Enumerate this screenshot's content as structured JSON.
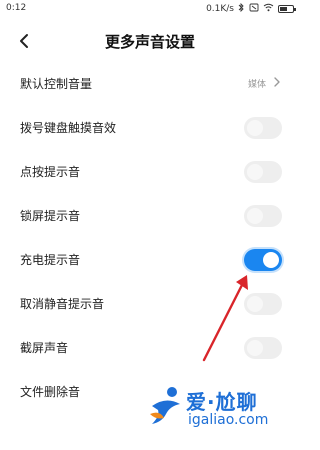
{
  "status_bar": {
    "time": "0:12",
    "network_speed": "0.1K/s",
    "icons": [
      "bluetooth-icon",
      "mute-icon",
      "wifi-icon",
      "battery-icon"
    ],
    "battery_level": 0.55
  },
  "header": {
    "title": "更多声音设置",
    "back_icon": "back-arrow-icon"
  },
  "settings": [
    {
      "id": "default-volume",
      "label": "默认控制音量",
      "type": "link",
      "value": "媒体"
    },
    {
      "id": "dial-keypad-sound",
      "label": "拨号键盘触摸音效",
      "type": "toggle",
      "on": false
    },
    {
      "id": "tap-sound",
      "label": "点按提示音",
      "type": "toggle",
      "on": false
    },
    {
      "id": "lock-screen-sound",
      "label": "锁屏提示音",
      "type": "toggle",
      "on": false
    },
    {
      "id": "charging-sound",
      "label": "充电提示音",
      "type": "toggle",
      "on": true
    },
    {
      "id": "unmute-sound",
      "label": "取消静音提示音",
      "type": "toggle",
      "on": false
    },
    {
      "id": "screenshot-sound",
      "label": "截屏声音",
      "type": "toggle",
      "on": false
    },
    {
      "id": "file-delete-sound",
      "label": "文件删除音",
      "type": "toggle",
      "on": false
    }
  ],
  "colors": {
    "toggle_on": "#1a86f0",
    "toggle_off": "#eeeeee",
    "annotation_arrow": "#d9252a",
    "watermark": "#1e6fd6"
  },
  "watermark": {
    "brand": "爱·尬聊",
    "url": "igaliao.com"
  }
}
